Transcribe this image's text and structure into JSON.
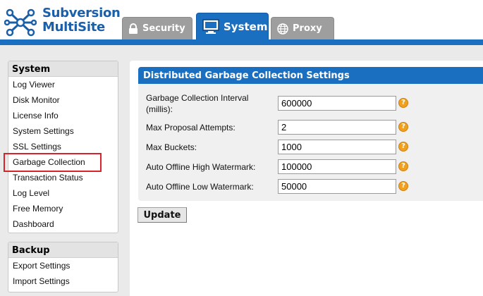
{
  "app": {
    "title_line1": "Subversion",
    "title_line2": "MultiSite"
  },
  "tabs": [
    {
      "label": "Security",
      "icon": "lock-icon"
    },
    {
      "label": "System",
      "icon": "monitor-icon",
      "active": true
    },
    {
      "label": "Proxy",
      "icon": "globe-icon"
    }
  ],
  "sidebar": {
    "system": {
      "title": "System",
      "items": [
        {
          "label": "Log Viewer"
        },
        {
          "label": "Disk Monitor"
        },
        {
          "label": "License Info"
        },
        {
          "label": "System Settings"
        },
        {
          "label": "SSL Settings"
        },
        {
          "label": "Garbage Collection",
          "active": true
        },
        {
          "label": "Transaction Status"
        },
        {
          "label": "Log Level"
        },
        {
          "label": "Free Memory"
        },
        {
          "label": "Dashboard"
        }
      ]
    },
    "backup": {
      "title": "Backup",
      "items": [
        {
          "label": "Export Settings"
        },
        {
          "label": "Import Settings"
        }
      ]
    }
  },
  "panel": {
    "title": "Distributed Garbage Collection Settings",
    "fields": [
      {
        "label_line1": "Garbage Collection Interval",
        "label_line2": "(millis):",
        "value": "600000"
      },
      {
        "label": "Max Proposal Attempts:",
        "value": "2"
      },
      {
        "label": "Max Buckets:",
        "value": "1000"
      },
      {
        "label": "Auto Offline High Watermark:",
        "value": "100000"
      },
      {
        "label": "Auto Offline Low Watermark:",
        "value": "50000"
      }
    ],
    "help_glyph": "?",
    "update_label": "Update"
  },
  "colors": {
    "brand_blue": "#1a6fc0",
    "highlight_red": "#d8232a",
    "help_orange": "#f0a020"
  }
}
